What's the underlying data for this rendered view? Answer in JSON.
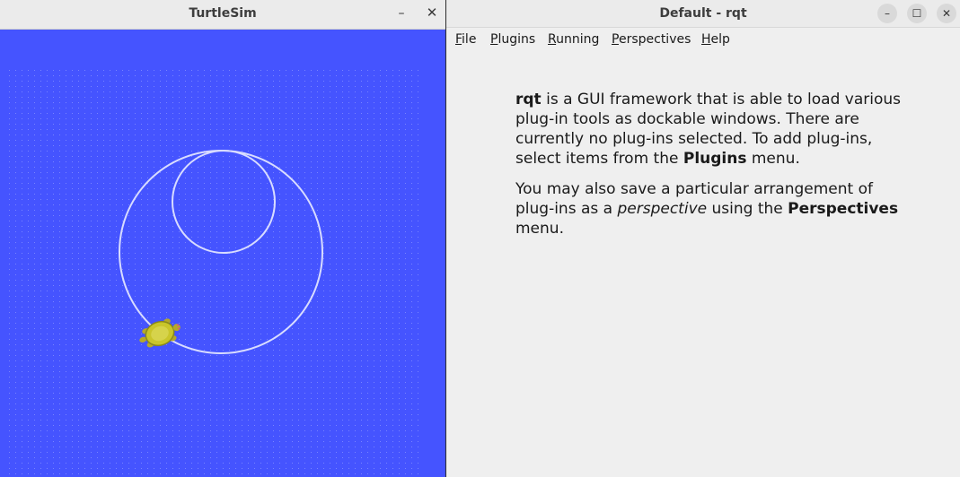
{
  "turtlesim": {
    "title": "TurtleSim",
    "min_glyph": "–",
    "close_glyph": "✕",
    "background_color": "#4554ff",
    "trail_color": "#d8dcff"
  },
  "rqt": {
    "title": "Default - rqt",
    "min_glyph": "–",
    "max_glyph": "☐",
    "close_glyph": "✕",
    "menu": [
      {
        "first": "F",
        "rest": "ile"
      },
      {
        "first": "P",
        "rest": "lugins"
      },
      {
        "first": "R",
        "rest": "unning"
      },
      {
        "first": "P",
        "rest": "erspectives"
      },
      {
        "first": "H",
        "rest": "elp"
      }
    ],
    "p1": {
      "bold1": "rqt",
      "text1": " is a GUI framework that is able to load various plug-in tools as dockable windows. There are currently no plug-ins selected. To add plug-ins, select items from the ",
      "bold2": "Plugins",
      "text2": " menu."
    },
    "p2": {
      "text1": "You may also save a particular arrangement of plug-ins as a ",
      "italic": "perspective",
      "text2": " using the ",
      "bold": "Perspectives",
      "text3": " menu."
    }
  }
}
